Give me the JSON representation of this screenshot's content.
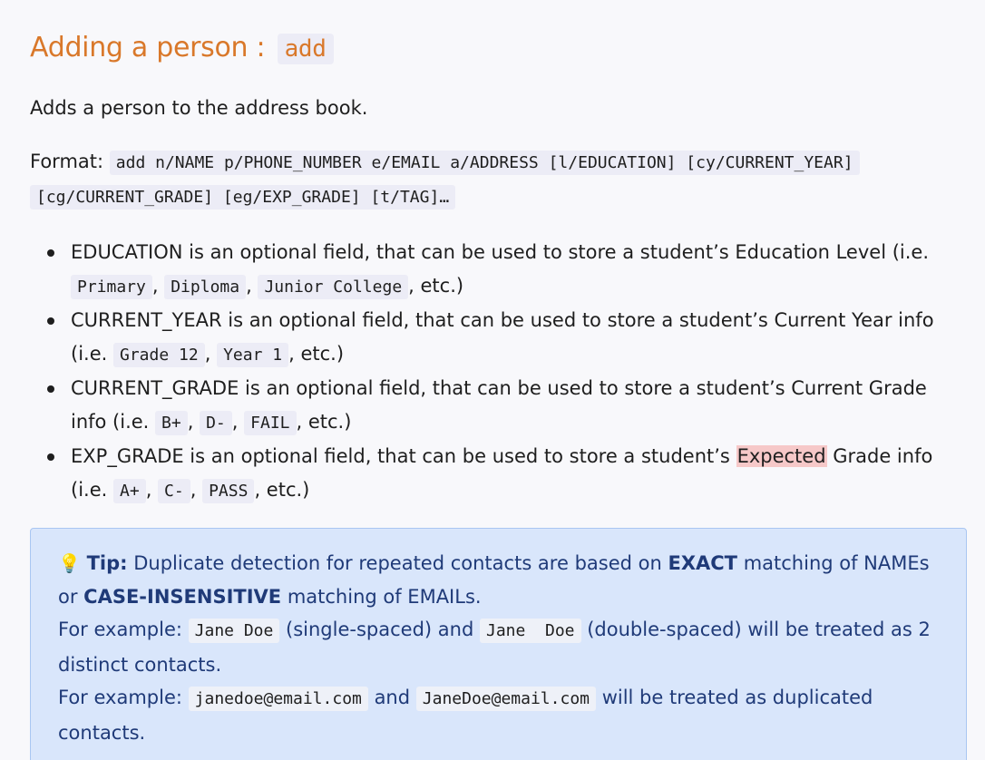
{
  "heading": {
    "title": "Adding a person :",
    "command": "add"
  },
  "description": "Adds a person to the address book.",
  "format": {
    "label": "Format:",
    "code_line1": "add n/NAME p/PHONE_NUMBER e/EMAIL a/ADDRESS [l/EDUCATION] [cy/CURRENT_YEAR]",
    "code_line2": "[cg/CURRENT_GRADE] [eg/EXP_GRADE] [t/TAG]…"
  },
  "notes": [
    {
      "text": "EDUCATION is an optional field, that can be used to store a student’s Education Level (i.e.",
      "examples": [
        "Primary",
        "Diploma",
        "Junior College"
      ],
      "suffix": ", etc.)"
    },
    {
      "text": "CURRENT_YEAR is an optional field, that can be used to store a student’s Current Year info (i.e.",
      "examples": [
        "Grade 12",
        "Year 1"
      ],
      "suffix": ", etc.)"
    },
    {
      "text": "CURRENT_GRADE is an optional field, that can be used to store a student’s Current Grade info (i.e.",
      "examples": [
        "B+",
        "D-",
        "FAIL"
      ],
      "suffix": ", etc.)"
    },
    {
      "text_before": "EXP_GRADE is an optional field, that can be used to store a student’s",
      "highlight": "Expected",
      "text_after": "Grade info (i.e.",
      "examples": [
        "A+",
        "C-",
        "PASS"
      ],
      "suffix": ", etc.)"
    }
  ],
  "tip": {
    "icon": "lightbulb-icon",
    "label": "Tip:",
    "line1_a": "Duplicate detection for repeated contacts are based on",
    "exact": "EXACT",
    "line1_b": "matching of NAMEs or",
    "case_insensitive": "CASE-INSENSITIVE",
    "line1_c": "matching of EMAILs.",
    "example_label": "For example:",
    "ex1_code_a": "Jane Doe",
    "ex1_mid": "(single-spaced) and",
    "ex1_code_b": "Jane  Doe",
    "ex1_end": "(double-spaced) will be treated as 2 distinct contacts.",
    "ex2_code_a": "janedoe@email.com",
    "ex2_mid": "and",
    "ex2_code_b": "JaneDoe@email.com",
    "ex2_end": "will be treated as duplicated contacts."
  },
  "colors": {
    "heading": "#d9782a",
    "tip_background": "#d9e6fb",
    "tip_text": "#1f3a78",
    "highlight": "#f6c8c8"
  }
}
